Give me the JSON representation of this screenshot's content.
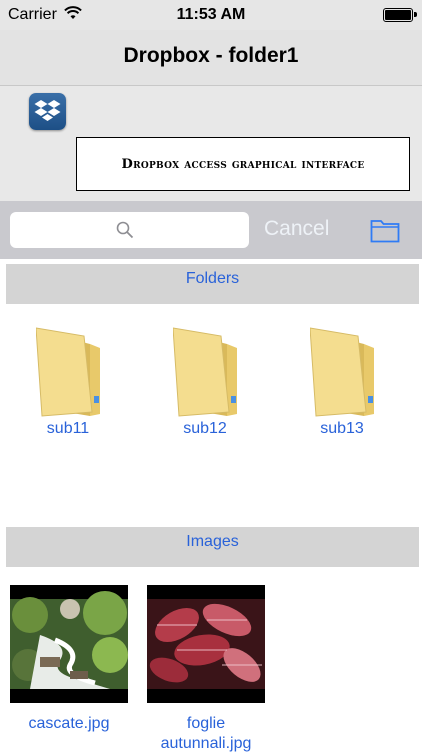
{
  "status_bar": {
    "carrier": "Carrier",
    "time": "11:53 AM"
  },
  "nav": {
    "title": "Dropbox - folder1"
  },
  "header": {
    "banner_text": "Dropbox access graphical interface"
  },
  "search": {
    "placeholder": "",
    "cancel_label": "Cancel"
  },
  "sections": {
    "folders": {
      "title": "Folders",
      "items": [
        {
          "label": "sub11"
        },
        {
          "label": "sub12"
        },
        {
          "label": "sub13"
        }
      ]
    },
    "images": {
      "title": "Images",
      "items": [
        {
          "label": "cascate.jpg"
        },
        {
          "label": "foglie autunnali.jpg"
        }
      ]
    }
  },
  "colors": {
    "accent": "#2962d9",
    "searchbar_bg": "#c9c9ce",
    "section_bg": "#d4d4d4",
    "folder_yellow": "#f1d98a"
  }
}
